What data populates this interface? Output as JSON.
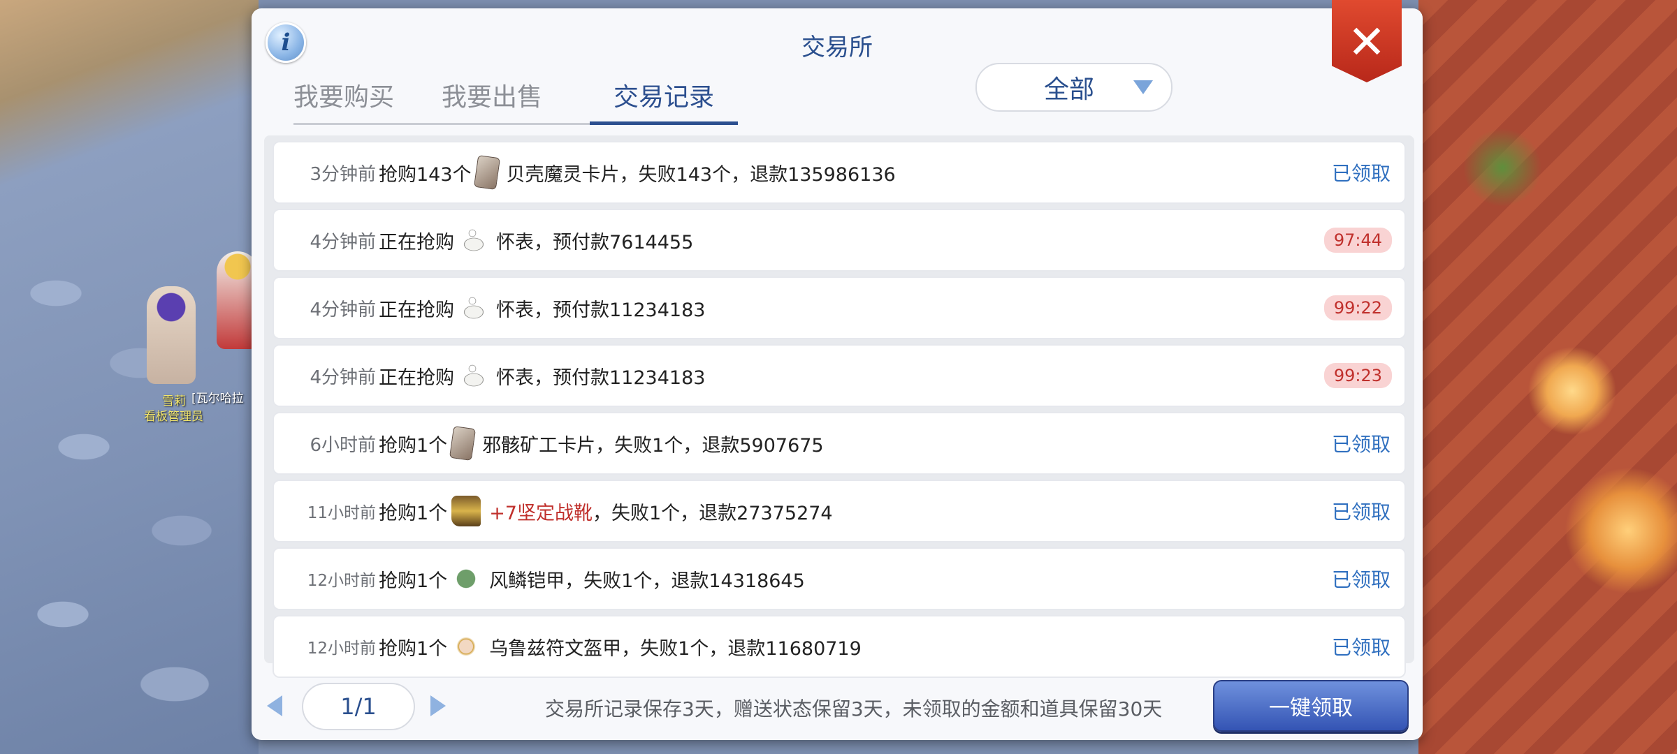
{
  "window": {
    "title": "交易所",
    "close_icon": "close-icon",
    "info_icon": "info-icon"
  },
  "tabs": [
    {
      "label": "我要购买"
    },
    {
      "label": "我要出售"
    },
    {
      "label": "交易记录",
      "active": true
    }
  ],
  "filter": {
    "value": "全部"
  },
  "background_npcs": [
    {
      "name": "雪莉",
      "title": "看板管理员"
    },
    {
      "name": "[瓦尔哈拉"
    }
  ],
  "records": [
    {
      "time": "3分钟前",
      "action": "抢购143个",
      "item_icon": "card-icon",
      "desc": "贝壳魔灵卡片，失败143个，退款135986136",
      "status": "已领取"
    },
    {
      "time": "4分钟前",
      "action": "正在抢购",
      "item_icon": "pocket-watch-icon",
      "desc": "怀表，预付款7614455",
      "timer": "97:44"
    },
    {
      "time": "4分钟前",
      "action": "正在抢购",
      "item_icon": "pocket-watch-icon",
      "desc": "怀表，预付款11234183",
      "timer": "99:22"
    },
    {
      "time": "4分钟前",
      "action": "正在抢购",
      "item_icon": "pocket-watch-icon",
      "desc": "怀表，预付款11234183",
      "timer": "99:23"
    },
    {
      "time": "6小时前",
      "action": "抢购1个",
      "item_icon": "card-icon",
      "desc": "邪骸矿工卡片，失败1个，退款5907675",
      "status": "已领取"
    },
    {
      "time": "11小时前",
      "action": "抢购1个",
      "item_icon": "boots-icon",
      "desc_highlight": "+7坚定战靴",
      "desc": "，失败1个，退款27375274",
      "status": "已领取"
    },
    {
      "time": "12小时前",
      "action": "抢购1个",
      "item_icon": "armor-icon",
      "desc": "风鳞铠甲，失败1个，退款14318645",
      "status": "已领取"
    },
    {
      "time": "12小时前",
      "action": "抢购1个",
      "item_icon": "rune-armor-icon",
      "desc": "乌鲁兹符文盔甲，失败1个，退款11680719",
      "status": "已领取"
    }
  ],
  "footer": {
    "page": "1/1",
    "note": "交易所记录保存3天，赠送状态保留3天，未领取的金额和道具保留30天",
    "claim_all": "一键领取"
  },
  "colors": {
    "accent": "#2a4f8e",
    "status_blue": "#2f6fbf",
    "timer_red": "#c0302c",
    "close_red": "#d23a24"
  }
}
